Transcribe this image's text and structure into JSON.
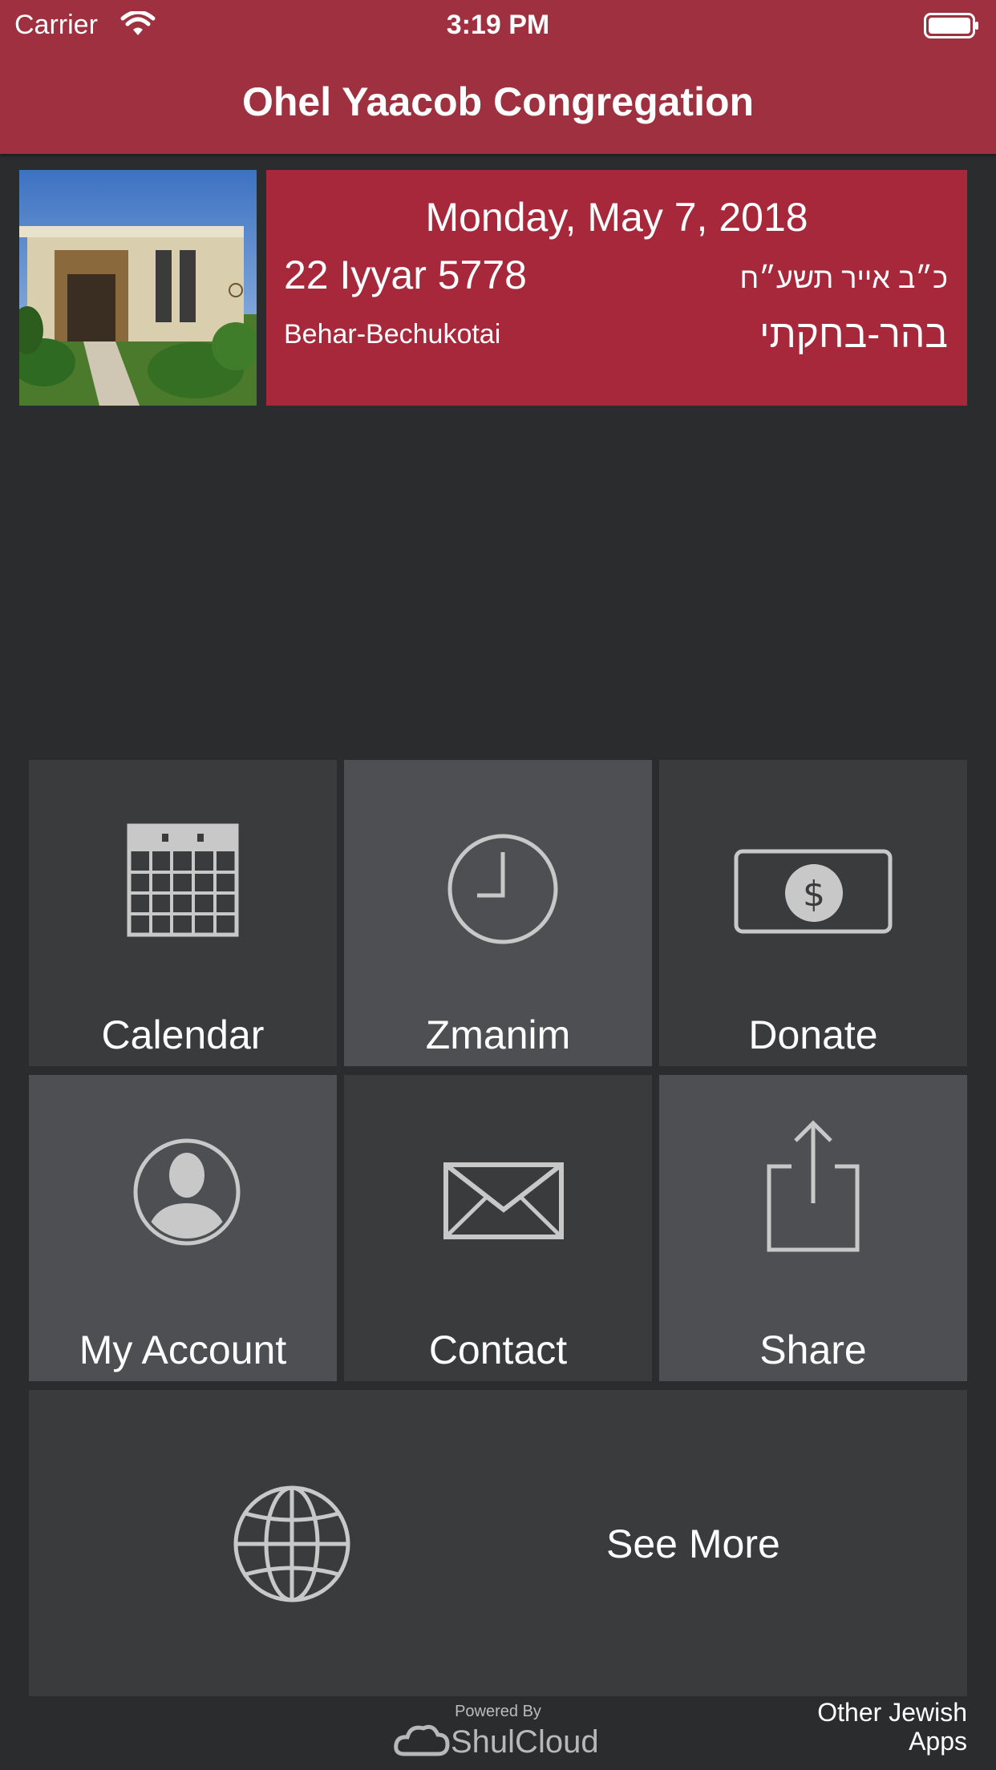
{
  "status_bar": {
    "carrier": "Carrier",
    "time": "3:19 PM"
  },
  "header": {
    "title": "Ohel Yaacob Congregation",
    "background_color": "#9e3040"
  },
  "date_panel": {
    "gregorian_date": "Monday, May 7, 2018",
    "hebrew_date_english": "22 Iyyar 5778",
    "hebrew_date_hebrew": "כ״ב אייר תשע״ח",
    "parsha_english": "Behar-Bechukotai",
    "parsha_hebrew": "בהר-בחקתי",
    "background_color": "#a7283a"
  },
  "menu": {
    "tiles": [
      {
        "label": "Calendar",
        "icon": "calendar-icon"
      },
      {
        "label": "Zmanim",
        "icon": "clock-icon"
      },
      {
        "label": "Donate",
        "icon": "dollar-bill-icon"
      },
      {
        "label": "My Account",
        "icon": "user-icon"
      },
      {
        "label": "Contact",
        "icon": "envelope-icon"
      },
      {
        "label": "Share",
        "icon": "share-icon"
      }
    ],
    "see_more": {
      "label": "See More",
      "icon": "globe-icon"
    }
  },
  "footer": {
    "powered_by": "Powered By",
    "brand": "ShulCloud",
    "other_apps_line1": "Other Jewish",
    "other_apps_line2": "Apps"
  }
}
